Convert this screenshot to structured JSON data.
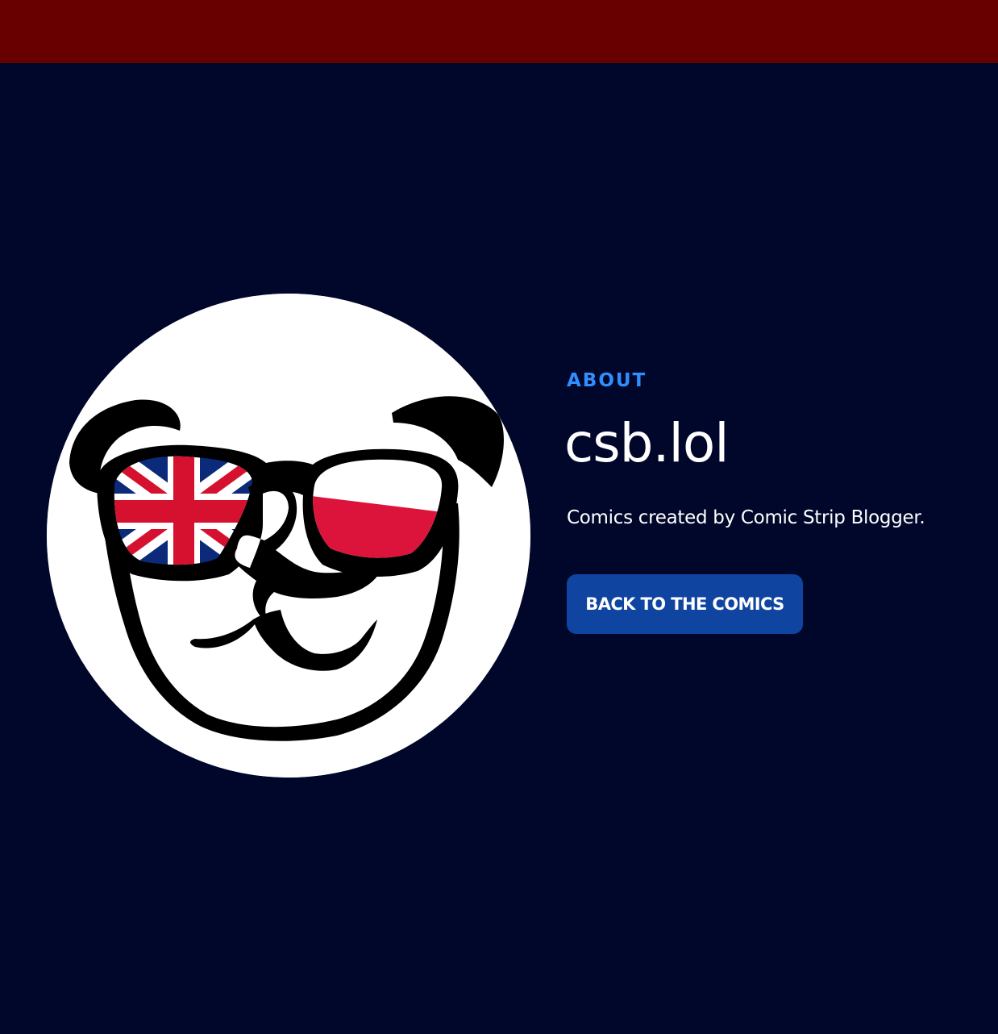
{
  "header": {
    "bar_color": "#680000"
  },
  "about": {
    "eyebrow": "ABOUT",
    "title": "csb.lol",
    "description": "Comics created by Comic Strip Blogger.",
    "cta_label": "BACK TO THE COMICS"
  },
  "avatar": {
    "icon": "panda-with-flag-sunglasses-icon",
    "left_lens_flag": "Union Jack",
    "right_lens_flag": "Poland"
  },
  "colors": {
    "background": "#00072a",
    "accent": "#2f8fff",
    "button": "#0f45a1",
    "text": "#ffffff"
  }
}
